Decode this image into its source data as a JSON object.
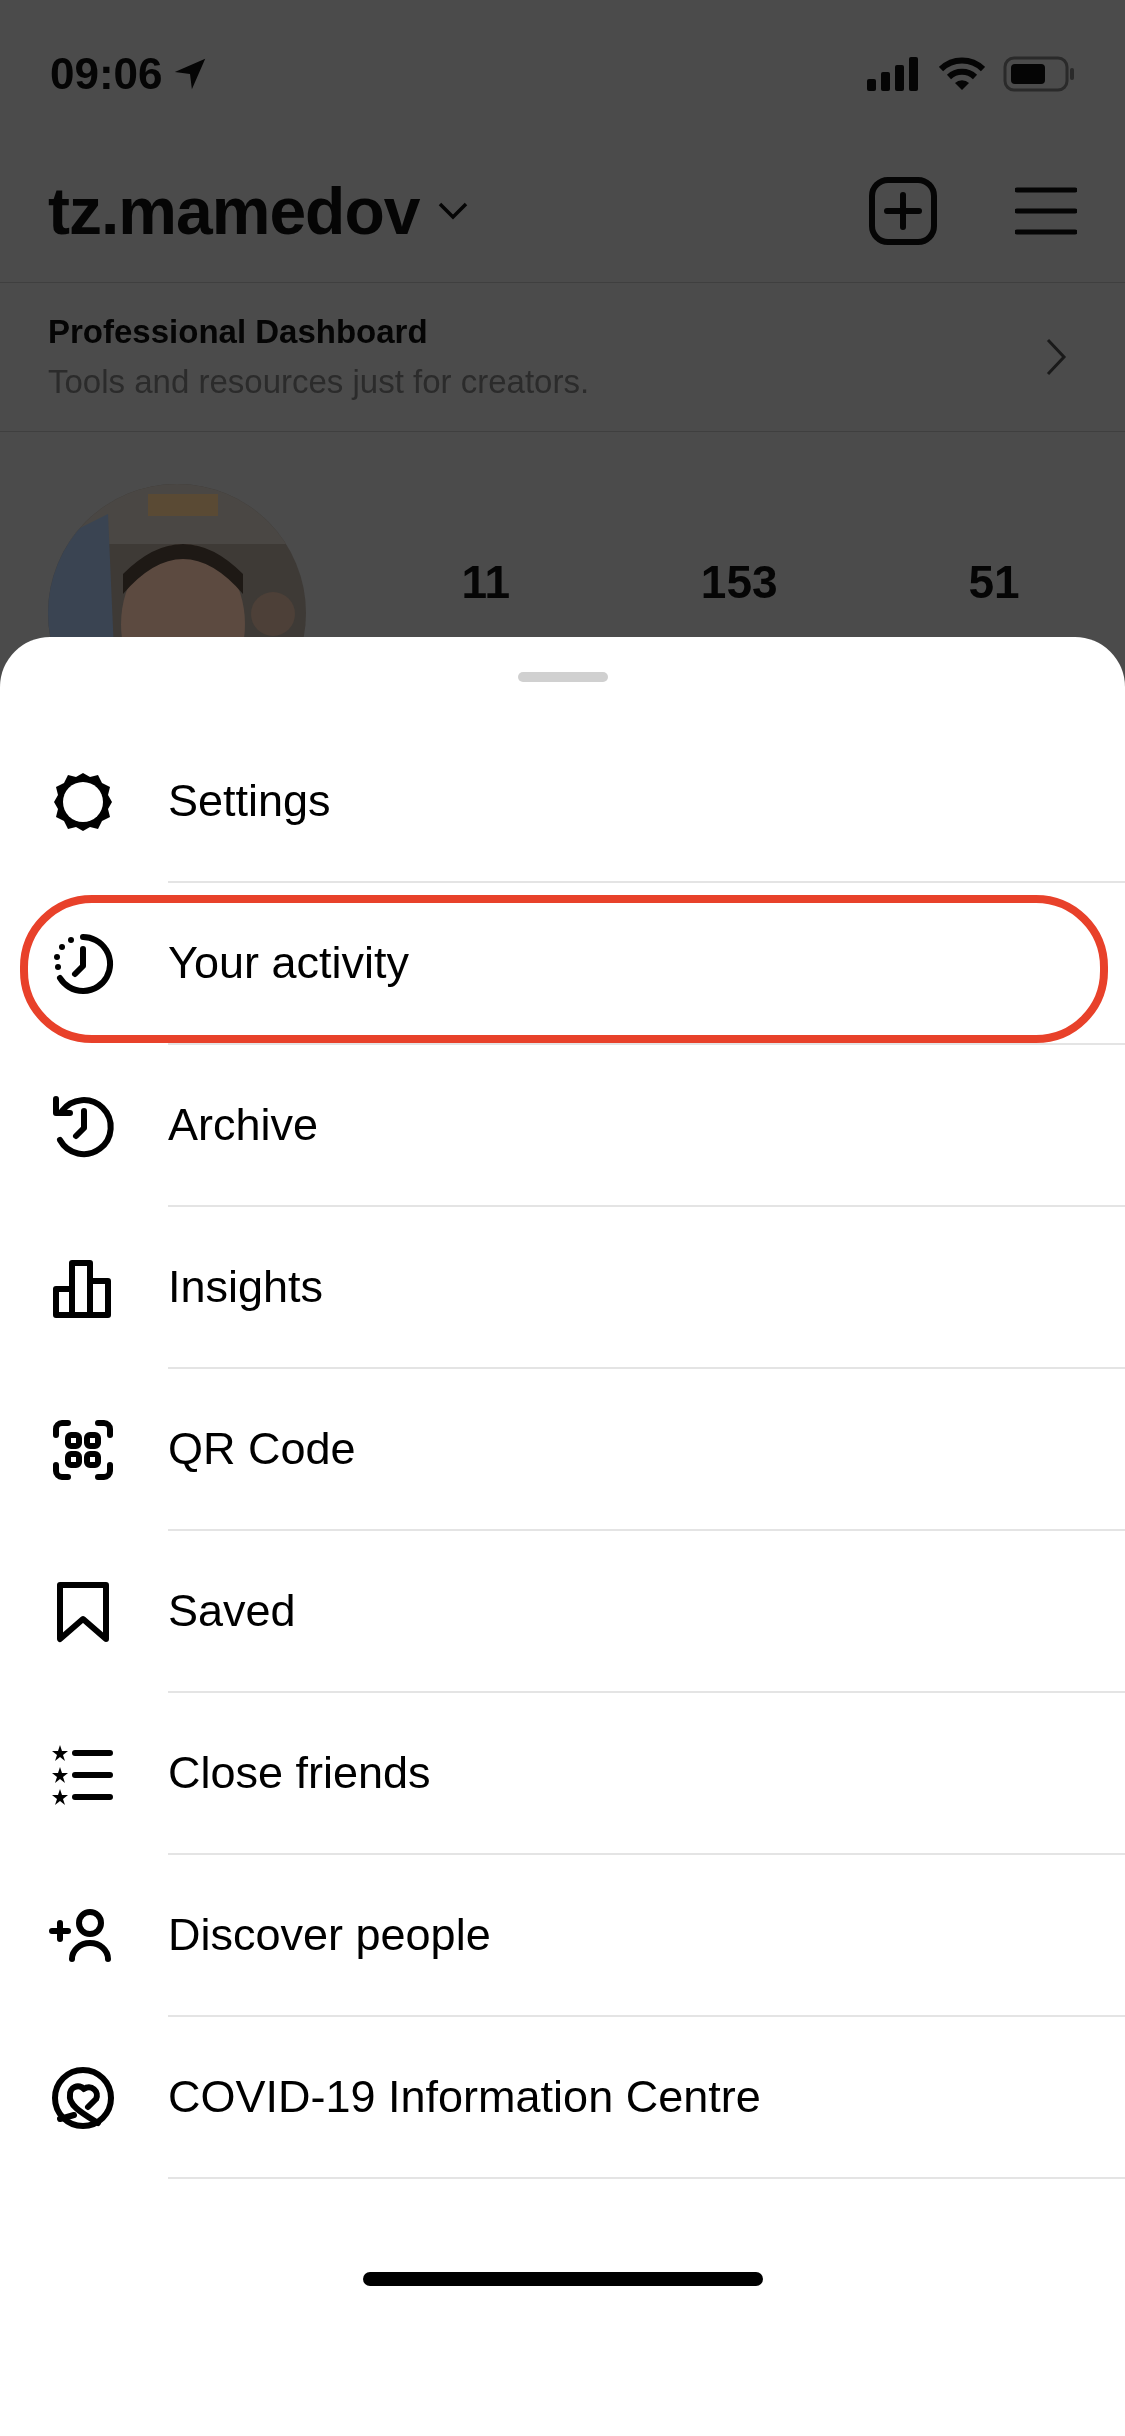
{
  "status_bar": {
    "time": "09:06"
  },
  "header": {
    "username": "tz.mamedov"
  },
  "dashboard": {
    "title": "Professional Dashboard",
    "subtitle": "Tools and resources just for creators."
  },
  "stats": [
    {
      "value": "11"
    },
    {
      "value": "153"
    },
    {
      "value": "51"
    }
  ],
  "menu": {
    "items": [
      {
        "label": "Settings",
        "highlighted": false
      },
      {
        "label": "Your activity",
        "highlighted": true
      },
      {
        "label": "Archive",
        "highlighted": false
      },
      {
        "label": "Insights",
        "highlighted": false
      },
      {
        "label": "QR Code",
        "highlighted": false
      },
      {
        "label": "Saved",
        "highlighted": false
      },
      {
        "label": "Close friends",
        "highlighted": false
      },
      {
        "label": "Discover people",
        "highlighted": false
      },
      {
        "label": "COVID-19 Information Centre",
        "highlighted": false
      }
    ]
  }
}
